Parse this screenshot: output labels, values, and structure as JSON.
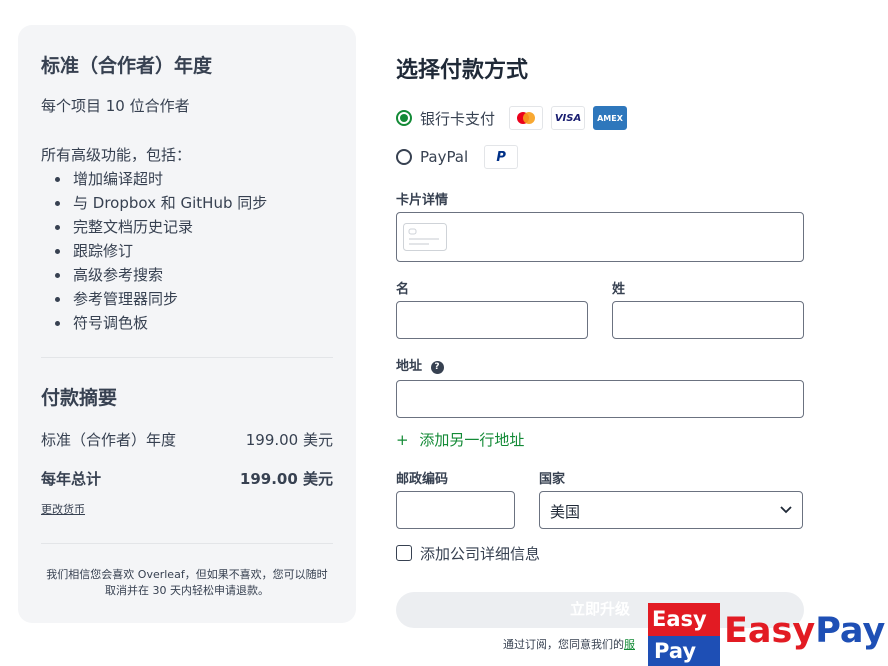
{
  "plan": {
    "title": "标准（合作者）年度",
    "subtitle": "每个项目 10 位合作者",
    "features_intro": "所有高级功能，包括：",
    "features": [
      "增加编译超时",
      "与 Dropbox 和 GitHub 同步",
      "完整文档历史记录",
      "跟踪修订",
      "高级参考搜索",
      "参考管理器同步",
      "符号调色板"
    ]
  },
  "summary": {
    "title": "付款摘要",
    "line_label": "标准（合作者）年度",
    "line_amount": "199.00 美元",
    "total_label": "每年总计",
    "total_amount": "199.00 美元",
    "change_currency": "更改货币",
    "refund_note": "我们相信您会喜欢 Overleaf，但如果不喜欢，您可以随时取消并在 30 天内轻松申请退款。"
  },
  "payment": {
    "title": "选择付款方式",
    "methods": [
      {
        "label": "银行卡支付",
        "selected": true
      },
      {
        "label": "PayPal",
        "selected": false
      }
    ],
    "card_brands": {
      "visa": "VISA",
      "amex": "AMEX",
      "paypal": "P"
    },
    "card_details_label": "卡片详情",
    "first_name_label": "名",
    "last_name_label": "姓",
    "address_label": "地址",
    "address_help": "?",
    "add_address_line": "添加另一行地址",
    "add_icon": "+",
    "postal_label": "邮政编码",
    "country_label": "国家",
    "country_value": "美国",
    "company_checkbox_label": "添加公司详细信息",
    "upgrade_button": "立即升级",
    "terms_prefix": "通过订阅，您同意我们的",
    "terms_link": "服"
  },
  "watermark": {
    "badge_top": "Easy",
    "badge_bottom": "Pay",
    "text_easy": "Easy",
    "text_pay": "Pay"
  },
  "colors": {
    "accent_green": "#138a36",
    "panel_bg": "#f4f5f7",
    "easy_red": "#e21b23",
    "pay_blue": "#1e4fb5"
  }
}
